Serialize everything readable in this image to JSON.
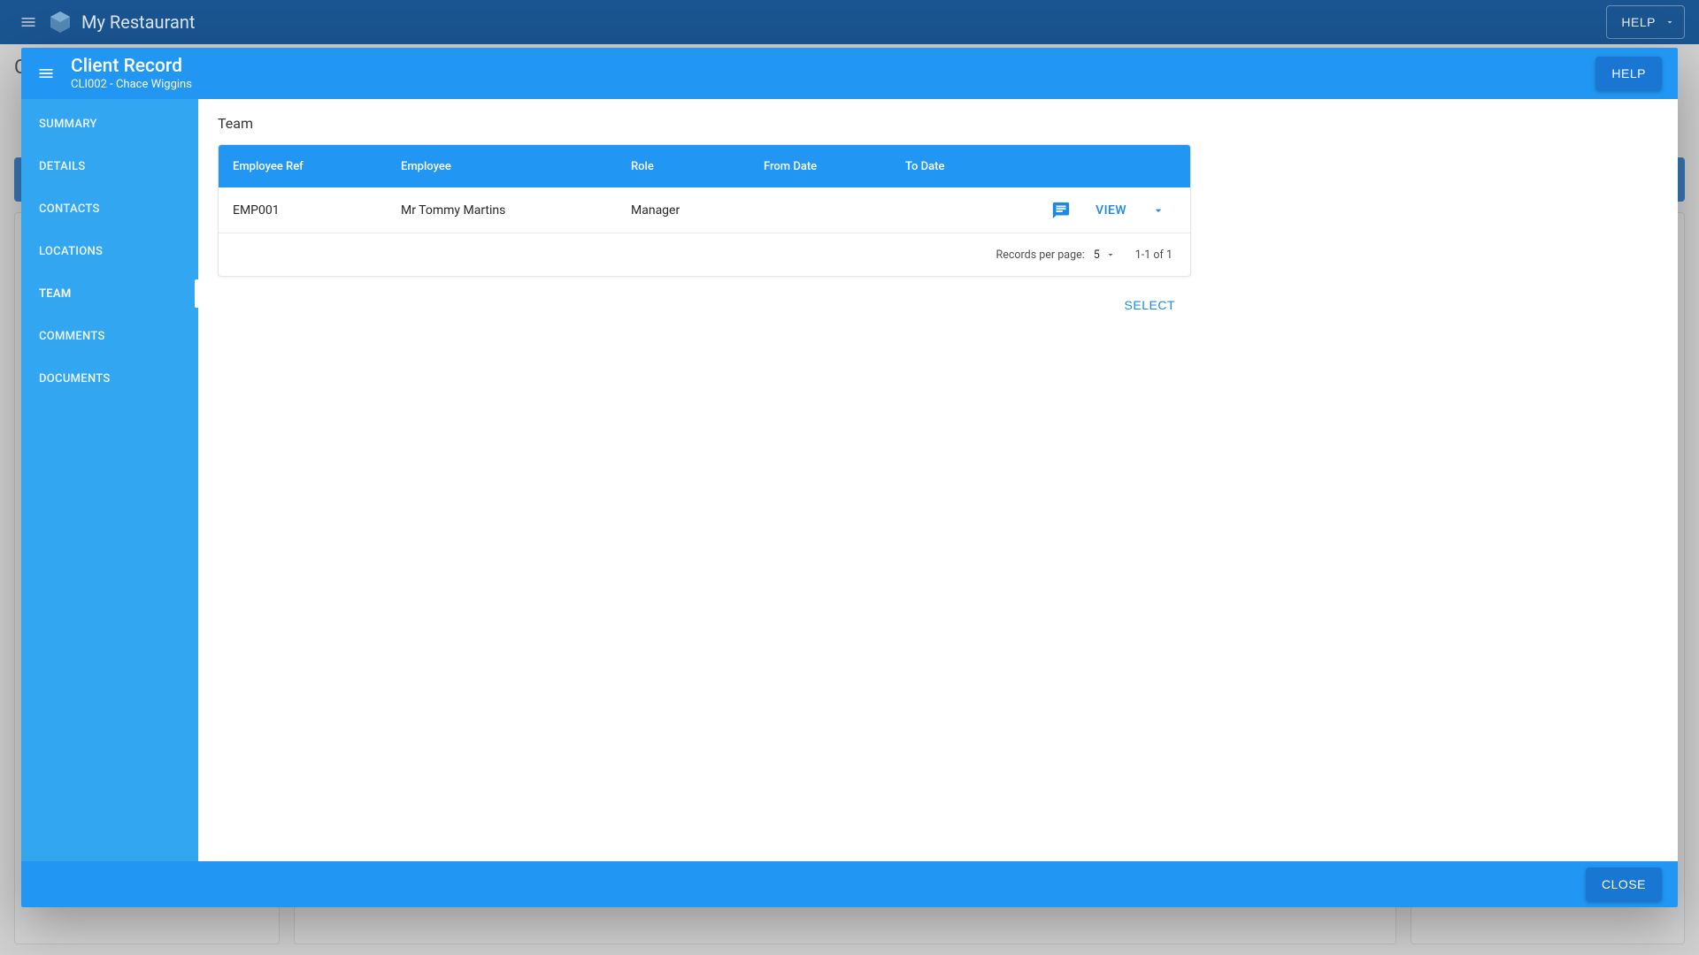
{
  "appbar": {
    "title": "My Restaurant",
    "help_label": "HELP"
  },
  "dialog": {
    "title": "Client Record",
    "subtitle": "CLI002 - Chace Wiggins",
    "help_label": "HELP",
    "close_label": "CLOSE"
  },
  "sidebar": {
    "items": [
      {
        "label": "SUMMARY"
      },
      {
        "label": "DETAILS"
      },
      {
        "label": "CONTACTS"
      },
      {
        "label": "LOCATIONS"
      },
      {
        "label": "TEAM"
      },
      {
        "label": "COMMENTS"
      },
      {
        "label": "DOCUMENTS"
      }
    ],
    "active_index": 4
  },
  "team": {
    "section_title": "Team",
    "columns": {
      "ref": "Employee Ref",
      "emp": "Employee",
      "role": "Role",
      "from": "From Date",
      "to": "To Date"
    },
    "rows": [
      {
        "ref": "EMP001",
        "emp": "Mr Tommy Martins",
        "role": "Manager",
        "from": "",
        "to": ""
      }
    ],
    "row_action_label": "VIEW",
    "select_label": "SELECT",
    "pager": {
      "rpp_label": "Records per page:",
      "rpp_value": "5",
      "range": "1-1 of 1"
    }
  }
}
